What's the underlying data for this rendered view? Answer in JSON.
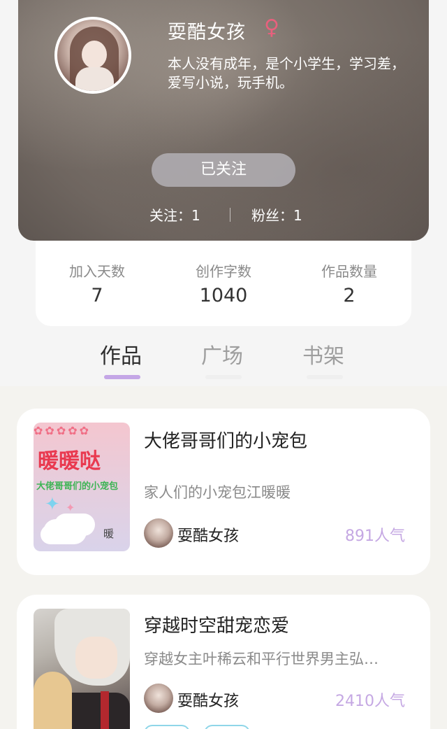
{
  "profile": {
    "username": "耍酷女孩",
    "gender_icon": "female-symbol-icon",
    "gender_glyph": "♀",
    "bio": "本人没有成年，是个小学生，学习差，爱写小说，玩手机。",
    "follow_button": "已关注",
    "following_text": "关注：1",
    "fans_text": "粉丝：1"
  },
  "stats": [
    {
      "label": "加入天数",
      "value": "7"
    },
    {
      "label": "创作字数",
      "value": "1040"
    },
    {
      "label": "作品数量",
      "value": "2"
    }
  ],
  "tabs": [
    {
      "label": "作品",
      "active": true
    },
    {
      "label": "广场",
      "active": false
    },
    {
      "label": "书架",
      "active": false
    }
  ],
  "books": [
    {
      "title": "大佬哥哥们的小宠包",
      "description": "家人们的小宠包江暖暖",
      "author": "耍酷女孩",
      "popularity": "891人气",
      "cover_title": "暖暖哒",
      "cover_subtitle": "大佬哥哥们的小宠包",
      "cover_signature": "暖"
    },
    {
      "title": "穿越时空甜宠恋爱",
      "description": "穿越女主叶稀云和平行世界男主弘…",
      "author": "耍酷女孩",
      "popularity": "2410人气"
    }
  ],
  "colors": {
    "accent_purple": "#c5a8e3",
    "gender_pink": "#e8607d",
    "tag_cyan": "#8fd6e8"
  }
}
